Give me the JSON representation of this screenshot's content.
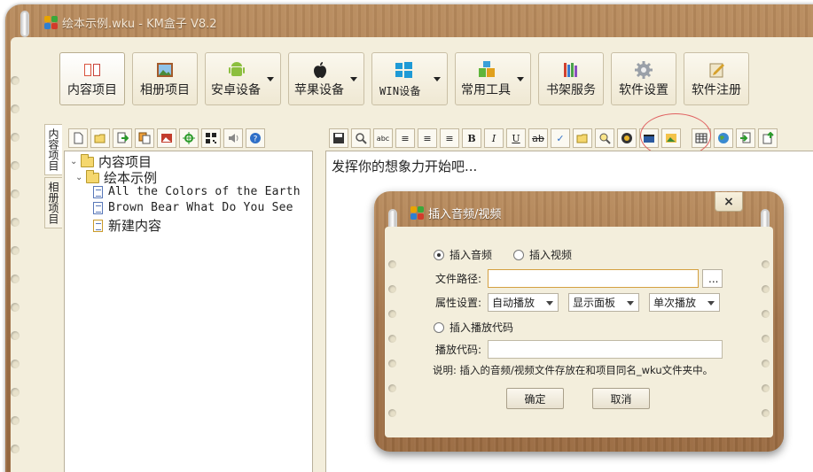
{
  "window": {
    "title": "绘本示例.wku - KM盒子 V8.2"
  },
  "toolbar": {
    "buttons": [
      {
        "label": "内容项目",
        "icon": "book-icon"
      },
      {
        "label": "相册项目",
        "icon": "photo-album-icon"
      },
      {
        "label": "安卓设备",
        "icon": "android-icon"
      },
      {
        "label": "苹果设备",
        "icon": "apple-icon"
      },
      {
        "label": "WIN设备",
        "icon": "windows-icon"
      },
      {
        "label": "常用工具",
        "icon": "blocks-icon"
      },
      {
        "label": "书架服务",
        "icon": "bookshelf-icon"
      },
      {
        "label": "软件设置",
        "icon": "gear-icon"
      },
      {
        "label": "软件注册",
        "icon": "register-icon"
      }
    ]
  },
  "side_tabs": {
    "content": "内容项目",
    "album": "相册项目"
  },
  "tree": {
    "root": "内容项目",
    "folder": "绘本示例",
    "items": [
      "All the Colors of the Earth",
      "Brown Bear What Do You See",
      "新建内容"
    ]
  },
  "editor": {
    "placeholder_text": "发挥你的想象力开始吧..."
  },
  "dialog": {
    "title": "插入音频/视频",
    "close": "×",
    "radio_audio": "插入音频",
    "radio_video": "插入视频",
    "file_path_label": "文件路径:",
    "browse": "...",
    "attr_label": "属性设置:",
    "select_autoplay": "自动播放",
    "select_panel": "显示面板",
    "select_repeat": "单次播放",
    "radio_code": "插入播放代码",
    "code_label": "播放代码:",
    "note": "说明: 插入的音频/视频文件存放在和项目同名_wku文件夹中。",
    "ok": "确定",
    "cancel": "取消"
  },
  "colors": {
    "wood": "#a97a4e",
    "paper": "#f3eedc",
    "highlight": "#e06060"
  }
}
